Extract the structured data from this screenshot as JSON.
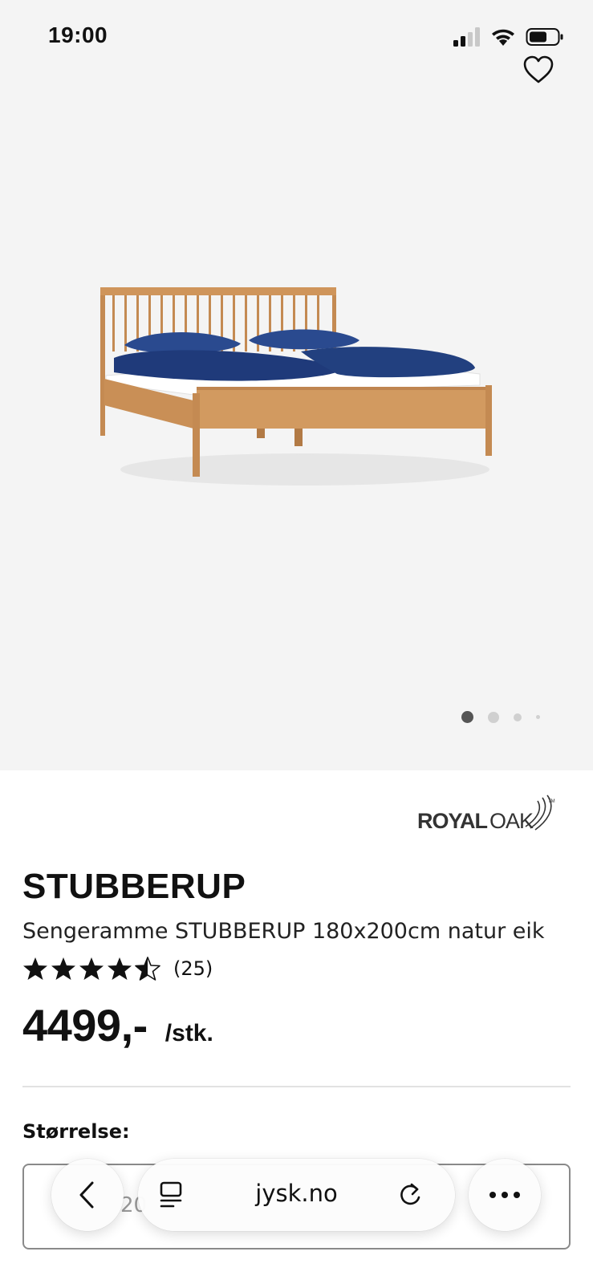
{
  "status_bar": {
    "time": "19:00"
  },
  "gallery": {
    "image_count": 4,
    "active_index": 0
  },
  "brand": {
    "name_bold": "ROYAL",
    "name_light": "OAK",
    "tm": "TM"
  },
  "product": {
    "name": "STUBBERUP",
    "description": "Sengeramme STUBBERUP 180x200cm natur eik",
    "rating": 4.5,
    "rating_count": "(25)",
    "price": "4499,-",
    "unit": "/stk."
  },
  "size": {
    "label": "Størrelse:",
    "value_partial": "20"
  },
  "browser": {
    "url": "jysk.no"
  },
  "colors": {
    "gallery_bg": "#f4f4f4",
    "wood": "#c98f56",
    "bedding": "#1f3a7a"
  }
}
